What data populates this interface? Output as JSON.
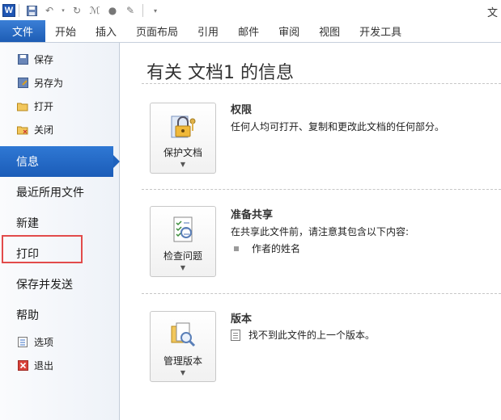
{
  "qat": {
    "app_logo": "W",
    "title_fragment": "文"
  },
  "tabs": {
    "file": "文件",
    "items": [
      "开始",
      "插入",
      "页面布局",
      "引用",
      "邮件",
      "审阅",
      "视图",
      "开发工具"
    ]
  },
  "nav": {
    "save": "保存",
    "save_as": "另存为",
    "open": "打开",
    "close": "关闭",
    "info": "信息",
    "recent": "最近所用文件",
    "new": "新建",
    "print": "打印",
    "save_send": "保存并发送",
    "help": "帮助",
    "options": "选项",
    "exit": "退出"
  },
  "main": {
    "title": "有关 文档1 的信息",
    "permissions": {
      "button_label": "保护文档",
      "title": "权限",
      "description": "任何人均可打开、复制和更改此文档的任何部分。"
    },
    "prepare": {
      "button_label": "检查问题",
      "title": "准备共享",
      "description": "在共享此文件前，请注意其包含以下内容:",
      "bullet": "作者的姓名"
    },
    "versions": {
      "button_label": "管理版本",
      "title": "版本",
      "description": "找不到此文件的上一个版本。"
    }
  },
  "colors": {
    "accent": "#1d5cb4",
    "highlight": "#e24b4b"
  }
}
